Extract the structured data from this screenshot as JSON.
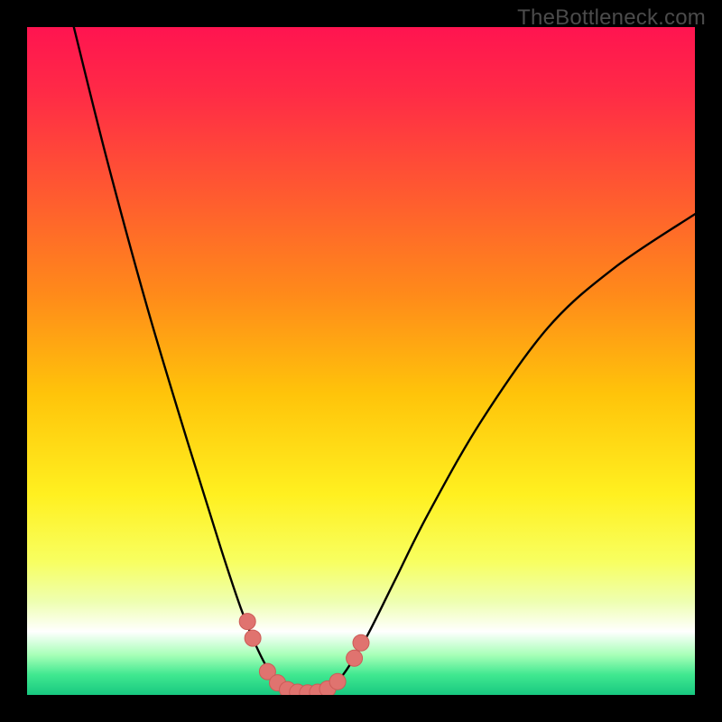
{
  "watermark": "TheBottleneck.com",
  "colors": {
    "frame": "#000000",
    "curve_stroke": "#000000",
    "marker_fill": "#e0736f",
    "marker_stroke": "#cc5b57",
    "gradient_stops": [
      {
        "offset": 0.0,
        "color": "#ff1450"
      },
      {
        "offset": 0.1,
        "color": "#ff2b46"
      },
      {
        "offset": 0.25,
        "color": "#ff5a30"
      },
      {
        "offset": 0.4,
        "color": "#ff8a1a"
      },
      {
        "offset": 0.55,
        "color": "#ffc40a"
      },
      {
        "offset": 0.7,
        "color": "#fff020"
      },
      {
        "offset": 0.8,
        "color": "#f8ff60"
      },
      {
        "offset": 0.86,
        "color": "#eeffb0"
      },
      {
        "offset": 0.905,
        "color": "#ffffff"
      },
      {
        "offset": 0.94,
        "color": "#a8ffb8"
      },
      {
        "offset": 0.97,
        "color": "#40e890"
      },
      {
        "offset": 1.0,
        "color": "#18c880"
      }
    ]
  },
  "chart_data": {
    "type": "line",
    "title": "",
    "xlabel": "",
    "ylabel": "",
    "xlim": [
      0,
      100
    ],
    "ylim": [
      0,
      100
    ],
    "grid": false,
    "curve": [
      {
        "x": 7,
        "y": 100
      },
      {
        "x": 12,
        "y": 80
      },
      {
        "x": 18,
        "y": 58
      },
      {
        "x": 24,
        "y": 38
      },
      {
        "x": 29,
        "y": 22
      },
      {
        "x": 32,
        "y": 13
      },
      {
        "x": 34,
        "y": 8
      },
      {
        "x": 36,
        "y": 4
      },
      {
        "x": 38,
        "y": 1.5
      },
      {
        "x": 40,
        "y": 0.5
      },
      {
        "x": 42,
        "y": 0.3
      },
      {
        "x": 44,
        "y": 0.5
      },
      {
        "x": 46,
        "y": 1.5
      },
      {
        "x": 48,
        "y": 4
      },
      {
        "x": 51,
        "y": 9
      },
      {
        "x": 55,
        "y": 17
      },
      {
        "x": 60,
        "y": 27
      },
      {
        "x": 68,
        "y": 41
      },
      {
        "x": 78,
        "y": 55
      },
      {
        "x": 88,
        "y": 64
      },
      {
        "x": 100,
        "y": 72
      }
    ],
    "markers": [
      {
        "x": 33.0,
        "y": 11.0
      },
      {
        "x": 33.8,
        "y": 8.5
      },
      {
        "x": 36.0,
        "y": 3.5
      },
      {
        "x": 37.5,
        "y": 1.8
      },
      {
        "x": 39.0,
        "y": 0.8
      },
      {
        "x": 40.5,
        "y": 0.4
      },
      {
        "x": 42.0,
        "y": 0.3
      },
      {
        "x": 43.5,
        "y": 0.4
      },
      {
        "x": 45.0,
        "y": 0.9
      },
      {
        "x": 46.5,
        "y": 2.0
      },
      {
        "x": 49.0,
        "y": 5.5
      },
      {
        "x": 50.0,
        "y": 7.8
      }
    ]
  }
}
